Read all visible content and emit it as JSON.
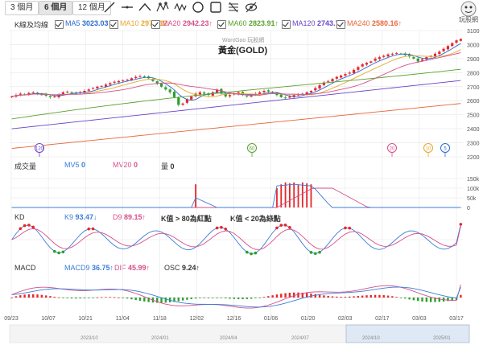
{
  "toolbar": {
    "ranges": [
      {
        "label": "3 個月",
        "active": false
      },
      {
        "label": "6 個月",
        "active": true
      },
      {
        "label": "12 個月",
        "active": false
      }
    ],
    "tools": [
      "line-tool-icon",
      "horizontal-line-icon",
      "trend-line-icon",
      "wave-pattern-icon",
      "wave-pattern-alt-icon",
      "ellipse-icon",
      "rectangle-icon",
      "fibonacci-icon",
      "hide-icon"
    ]
  },
  "logo_text": "玩股網",
  "legend": {
    "label": "K線及均線",
    "ma": [
      {
        "name": "MA5",
        "value": "3023.03↑",
        "color": "#2a6ad0"
      },
      {
        "name": "MA10",
        "value": "2976.12↑",
        "color": "#e6a82c"
      },
      {
        "name": "MA20",
        "value": "2942.23↑",
        "color": "#d64f8a"
      },
      {
        "name": "MA60",
        "value": "2823.91↑",
        "color": "#5aa02c"
      },
      {
        "name": "MA120",
        "value": "2743.70↑",
        "color": "#6a45c8"
      },
      {
        "name": "MA240",
        "value": "2580.16↑",
        "color": "#e8673a"
      }
    ]
  },
  "watermark": "WantGoo 玩股網",
  "chart_title": "黃金(GOLD)",
  "volume_panel": {
    "label": "成交量",
    "mv5": {
      "name": "MV5",
      "value": "0"
    },
    "mv20": {
      "name": "MV20",
      "value": "0"
    },
    "vol": {
      "name": "量",
      "value": "0"
    }
  },
  "kd_panel": {
    "label": "KD",
    "k9": {
      "name": "K9",
      "value": "93.47↓"
    },
    "d9": {
      "name": "D9",
      "value": "89.15↑"
    },
    "note1": "K值 > 80為紅點",
    "note2": "K值 < 20為綠點"
  },
  "macd_panel": {
    "label": "MACD",
    "macd9": {
      "name": "MACD9",
      "value": "36.75↑"
    },
    "dif": {
      "name": "DIF",
      "value": "45.99↑"
    },
    "osc": {
      "name": "OSC",
      "value": "9.24↑"
    }
  },
  "colors": {
    "up": "#e8262a",
    "down": "#2ca02c",
    "grid": "#e6e6e6",
    "signal_blue": "#3b7dd8"
  },
  "chart_data": {
    "type": "candlestick",
    "title": "黃金(GOLD)",
    "price_axis": {
      "ticks": [
        3100,
        3000,
        2900,
        2800,
        2700,
        2600,
        2500,
        2400,
        2300,
        2200
      ],
      "ylim": [
        2200,
        3100
      ]
    },
    "volume_axis": {
      "ticks": [
        "150k",
        "100k",
        "50k",
        "0"
      ],
      "ylim": [
        0,
        150
      ]
    },
    "x_ticks": [
      "09/23",
      "10/07",
      "10/21",
      "11/04",
      "11/18",
      "12/02",
      "12/16",
      "01/06",
      "01/20",
      "02/03",
      "02/17",
      "03/03",
      "03/17"
    ],
    "navigator_labels": [
      "2023/10",
      "2024/01",
      "2024/04",
      "2024/07",
      "2024/10",
      "2025/01"
    ],
    "closes": [
      2630,
      2640,
      2650,
      2645,
      2655,
      2660,
      2650,
      2640,
      2635,
      2625,
      2630,
      2645,
      2660,
      2665,
      2655,
      2650,
      2660,
      2670,
      2680,
      2690,
      2700,
      2705,
      2715,
      2725,
      2735,
      2740,
      2745,
      2750,
      2760,
      2770,
      2775,
      2770,
      2760,
      2740,
      2720,
      2700,
      2680,
      2660,
      2625,
      2570,
      2580,
      2610,
      2630,
      2650,
      2660,
      2650,
      2640,
      2660,
      2680,
      2650,
      2630,
      2640,
      2650,
      2660,
      2640,
      2630,
      2640,
      2650,
      2660,
      2670,
      2665,
      2655,
      2640,
      2625,
      2620,
      2630,
      2640,
      2645,
      2650,
      2660,
      2670,
      2690,
      2710,
      2730,
      2740,
      2755,
      2770,
      2780,
      2790,
      2800,
      2820,
      2840,
      2860,
      2870,
      2880,
      2900,
      2910,
      2920,
      2930,
      2935,
      2940,
      2935,
      2925,
      2915,
      2900,
      2880,
      2895,
      2910,
      2920,
      2935,
      2950,
      2970,
      2990,
      3010,
      3030,
      3040
    ],
    "ma_series": [
      {
        "name": "MA5",
        "start": 2625,
        "end": 3023
      },
      {
        "name": "MA10",
        "start": 2620,
        "end": 2976
      },
      {
        "name": "MA20",
        "start": 2600,
        "end": 2942
      },
      {
        "name": "MA60",
        "start": 2470,
        "end": 2824
      },
      {
        "name": "MA120",
        "start": 2400,
        "end": 2744
      },
      {
        "name": "MA240",
        "start": 2260,
        "end": 2580
      }
    ],
    "ma_markers": [
      {
        "label": "120"
      },
      {
        "label": "60"
      },
      {
        "label": "20"
      },
      {
        "label": "10"
      },
      {
        "label": "5"
      }
    ],
    "volume_bars": [
      {
        "index": 43,
        "value": 120
      },
      {
        "index": 62,
        "value": 100
      },
      {
        "index": 63,
        "value": 120
      },
      {
        "index": 64,
        "value": 130
      },
      {
        "index": 65,
        "value": 125
      },
      {
        "index": 66,
        "value": 130
      },
      {
        "index": 67,
        "value": 120
      },
      {
        "index": 68,
        "value": 130
      },
      {
        "index": 69,
        "value": 125
      },
      {
        "index": 70,
        "value": 120
      }
    ],
    "kd": {
      "k_last": 93.47,
      "d_last": 89.15,
      "ylim": [
        0,
        100
      ]
    },
    "macd": {
      "macd9_last": 36.75,
      "dif_last": 45.99,
      "osc_last": 9.24
    }
  }
}
